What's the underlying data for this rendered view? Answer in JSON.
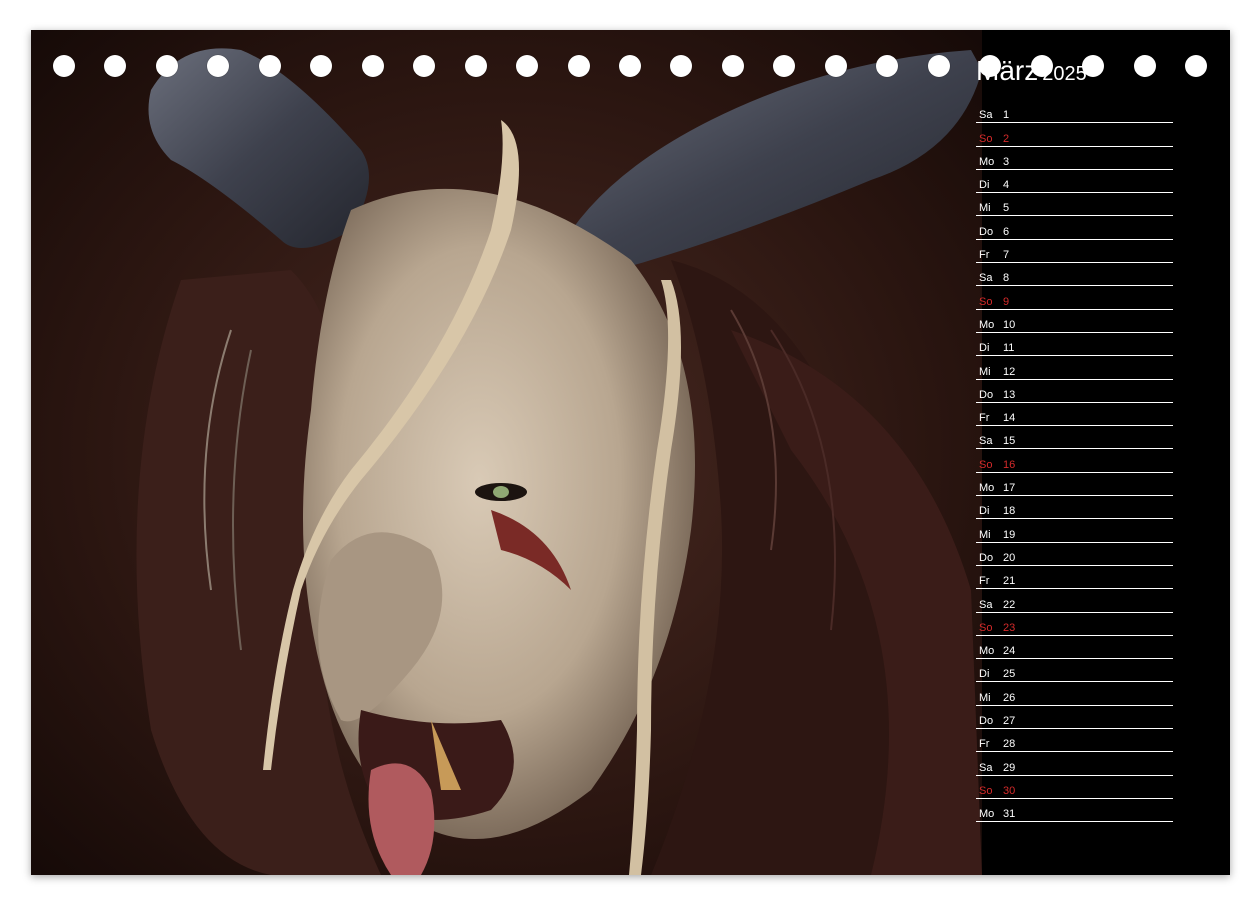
{
  "calendar": {
    "month": "März",
    "year": "2025",
    "sunday_color": "#d42a2a",
    "days": [
      {
        "dow": "Sa",
        "num": "1",
        "sunday": false
      },
      {
        "dow": "So",
        "num": "2",
        "sunday": true
      },
      {
        "dow": "Mo",
        "num": "3",
        "sunday": false
      },
      {
        "dow": "Di",
        "num": "4",
        "sunday": false
      },
      {
        "dow": "Mi",
        "num": "5",
        "sunday": false
      },
      {
        "dow": "Do",
        "num": "6",
        "sunday": false
      },
      {
        "dow": "Fr",
        "num": "7",
        "sunday": false
      },
      {
        "dow": "Sa",
        "num": "8",
        "sunday": false
      },
      {
        "dow": "So",
        "num": "9",
        "sunday": true
      },
      {
        "dow": "Mo",
        "num": "10",
        "sunday": false
      },
      {
        "dow": "Di",
        "num": "11",
        "sunday": false
      },
      {
        "dow": "Mi",
        "num": "12",
        "sunday": false
      },
      {
        "dow": "Do",
        "num": "13",
        "sunday": false
      },
      {
        "dow": "Fr",
        "num": "14",
        "sunday": false
      },
      {
        "dow": "Sa",
        "num": "15",
        "sunday": false
      },
      {
        "dow": "So",
        "num": "16",
        "sunday": true
      },
      {
        "dow": "Mo",
        "num": "17",
        "sunday": false
      },
      {
        "dow": "Di",
        "num": "18",
        "sunday": false
      },
      {
        "dow": "Mi",
        "num": "19",
        "sunday": false
      },
      {
        "dow": "Do",
        "num": "20",
        "sunday": false
      },
      {
        "dow": "Fr",
        "num": "21",
        "sunday": false
      },
      {
        "dow": "Sa",
        "num": "22",
        "sunday": false
      },
      {
        "dow": "So",
        "num": "23",
        "sunday": true
      },
      {
        "dow": "Mo",
        "num": "24",
        "sunday": false
      },
      {
        "dow": "Di",
        "num": "25",
        "sunday": false
      },
      {
        "dow": "Mi",
        "num": "26",
        "sunday": false
      },
      {
        "dow": "Do",
        "num": "27",
        "sunday": false
      },
      {
        "dow": "Fr",
        "num": "28",
        "sunday": false
      },
      {
        "dow": "Sa",
        "num": "29",
        "sunday": false
      },
      {
        "dow": "So",
        "num": "30",
        "sunday": true
      },
      {
        "dow": "Mo",
        "num": "31",
        "sunday": false
      }
    ]
  },
  "photo": {
    "subject": "krampus-mask-photo",
    "palette": {
      "background": "#2a1510",
      "fur": "#3b1f1a",
      "horn": "#4a4e5c",
      "mask": "#c8b7a3",
      "braid": "#d8c6a8"
    }
  },
  "binding": {
    "hole_count": 23
  }
}
